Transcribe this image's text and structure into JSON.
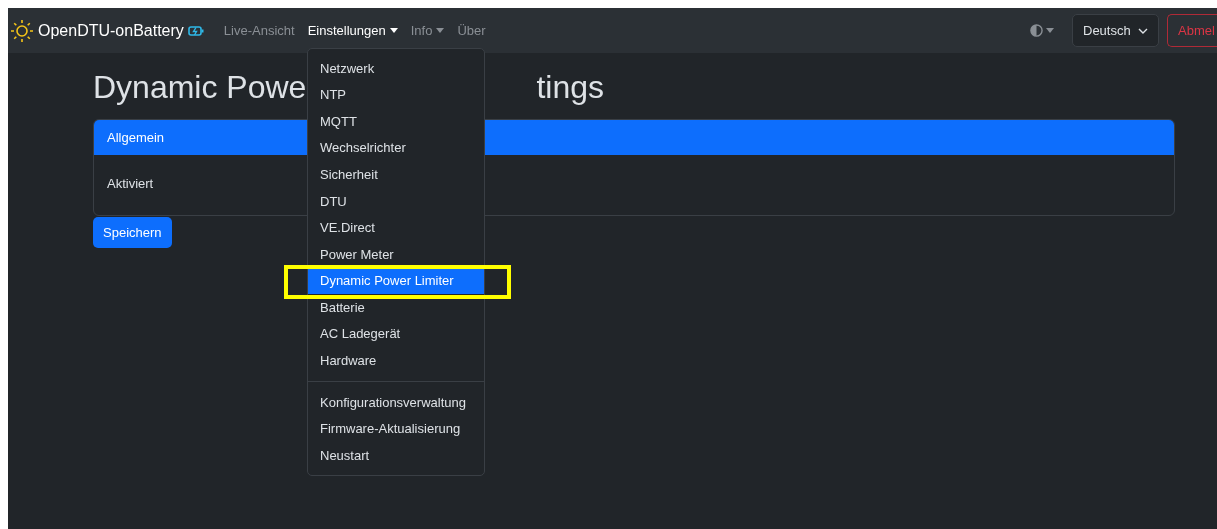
{
  "navbar": {
    "brand": "OpenDTU-onBattery",
    "items": [
      {
        "label": "Live-Ansicht",
        "selected": false,
        "dropdown": false
      },
      {
        "label": "Einstellungen",
        "selected": true,
        "dropdown": true
      },
      {
        "label": "Info",
        "selected": false,
        "dropdown": true
      },
      {
        "label": "Über",
        "selected": false,
        "dropdown": false
      }
    ],
    "language": "Deutsch",
    "logout": "Abmel"
  },
  "title_parts": [
    "Dynamic Powe",
    "tings"
  ],
  "card": {
    "header": "Allgemein",
    "rows": [
      {
        "label": "Aktiviert"
      }
    ]
  },
  "save_button": "Speichern",
  "menu": {
    "groups": [
      [
        {
          "label": "Netzwerk",
          "selected": false
        },
        {
          "label": "NTP",
          "selected": false
        },
        {
          "label": "MQTT",
          "selected": false
        },
        {
          "label": "Wechselrichter",
          "selected": false
        },
        {
          "label": "Sicherheit",
          "selected": false
        },
        {
          "label": "DTU",
          "selected": false
        },
        {
          "label": "VE.Direct",
          "selected": false
        },
        {
          "label": "Power Meter",
          "selected": false
        },
        {
          "label": "Dynamic Power Limiter",
          "selected": true
        },
        {
          "label": "Batterie",
          "selected": false
        },
        {
          "label": "AC Ladegerät",
          "selected": false
        },
        {
          "label": "Hardware",
          "selected": false
        }
      ],
      [
        {
          "label": "Konfigurationsverwaltung",
          "selected": false
        },
        {
          "label": "Firmware-Aktualisierung",
          "selected": false
        },
        {
          "label": "Neustart",
          "selected": false
        }
      ]
    ]
  }
}
